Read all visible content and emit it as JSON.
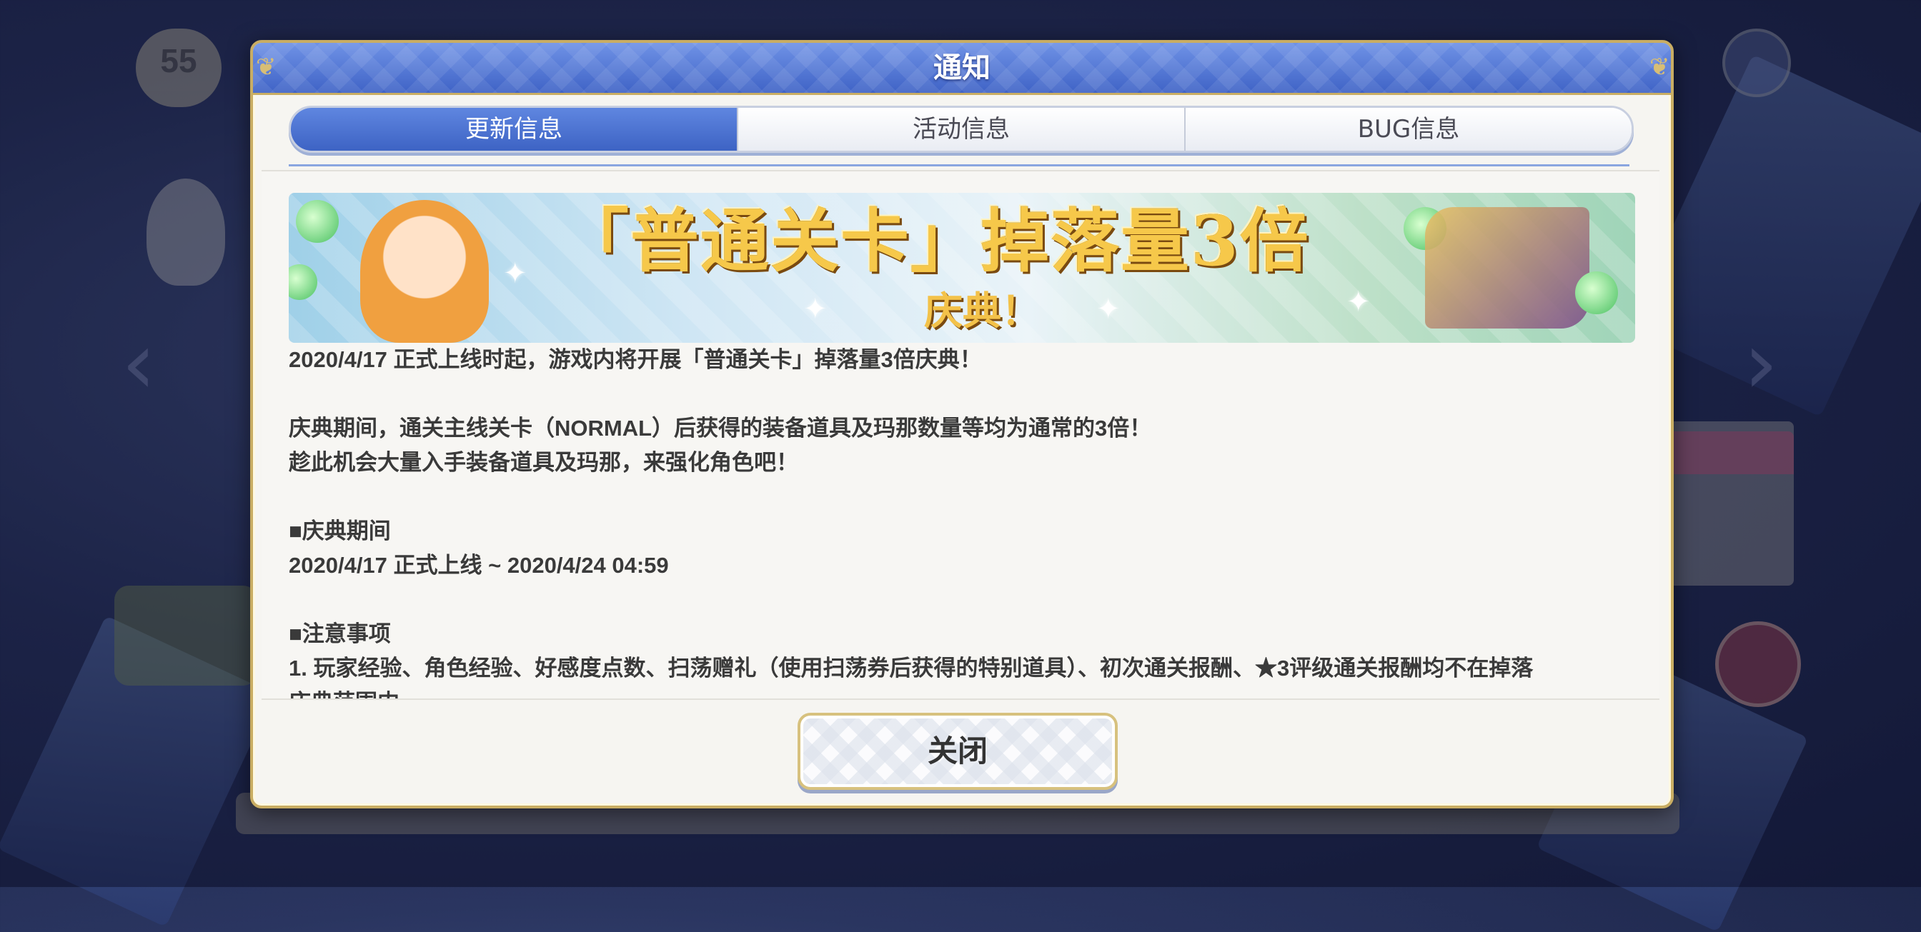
{
  "background": {
    "level_label": "",
    "level_value": "55"
  },
  "dialog": {
    "title": "通知",
    "tabs": [
      {
        "label": "更新信息",
        "active": true
      },
      {
        "label": "活动信息",
        "active": false
      },
      {
        "label": "BUG信息",
        "active": false
      }
    ],
    "banner": {
      "title": "「普通关卡」掉落量3倍",
      "subtitle": "庆典！"
    },
    "body_lines": [
      "2020/4/17 正式上线时起，游戏内将开展「普通关卡」掉落量3倍庆典！",
      "",
      "庆典期间，通关主线关卡（NORMAL）后获得的装备道具及玛那数量等均为通常的3倍！",
      "趁此机会大量入手装备道具及玛那，来强化角色吧！",
      "",
      "■庆典期间",
      "2020/4/17 正式上线 ~ 2020/4/24 04:59",
      "",
      "■注意事项",
      "1. 玩家经验、角色经验、好感度点数、扫荡赠礼（使用扫荡券后获得的特别道具）、初次通关报酬、★3评级通关报酬均不在掉落",
      "庆典范围内"
    ],
    "close_label": "关闭"
  },
  "colors": {
    "header_blue": "#3f63c6",
    "gold_border": "#c9ad63",
    "tab_active": "#5f86e0"
  }
}
